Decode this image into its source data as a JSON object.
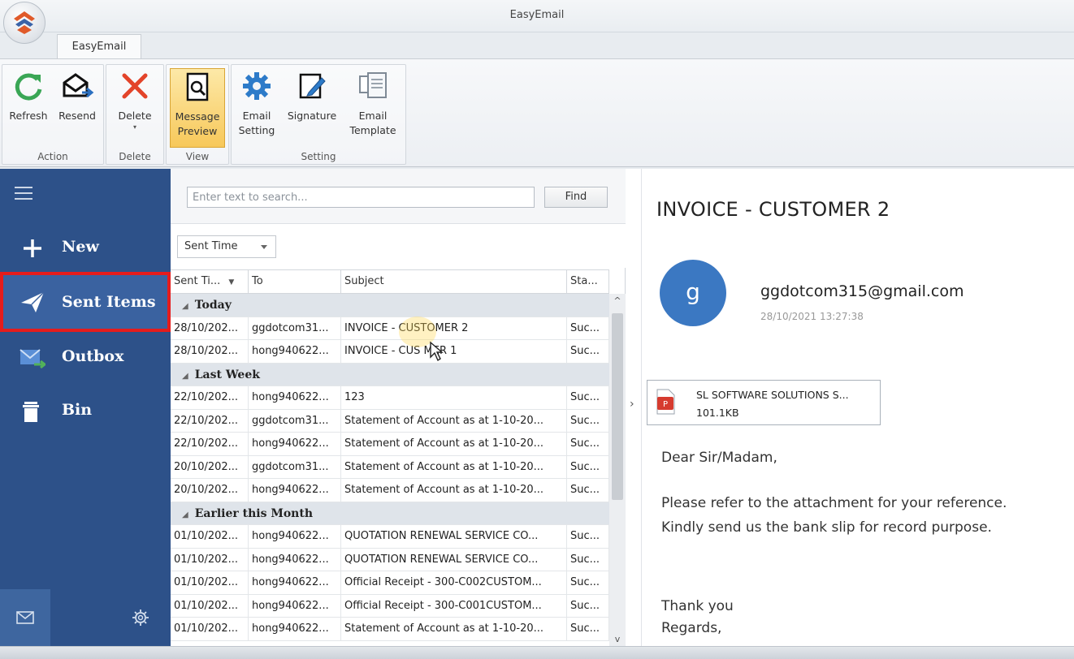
{
  "window": {
    "title": "EasyEmail",
    "tab": "EasyEmail"
  },
  "ribbon": {
    "groups": {
      "action": "Action",
      "delete": "Delete",
      "view": "View",
      "setting": "Setting"
    },
    "buttons": {
      "refresh": "Refresh",
      "resend": "Resend",
      "delete": "Delete",
      "message_preview_1": "Message",
      "message_preview_2": "Preview",
      "email_setting_1": "Email",
      "email_setting_2": "Setting",
      "signature": "Signature",
      "email_template_1": "Email",
      "email_template_2": "Template"
    }
  },
  "nav": {
    "items": [
      {
        "label": "New",
        "icon": "plus-icon"
      },
      {
        "label": "Sent Items",
        "icon": "paper-plane-icon"
      },
      {
        "label": "Outbox",
        "icon": "outbox-icon"
      },
      {
        "label": "Bin",
        "icon": "trash-icon"
      }
    ],
    "colors": {
      "background": "#2d5189",
      "highlight": "#e51c1c"
    }
  },
  "list": {
    "search_placeholder": "Enter text to search...",
    "find_label": "Find",
    "sort_label": "Sent Time",
    "columns": [
      "Sent Ti...",
      "To",
      "Subject",
      "Sta..."
    ],
    "groups": [
      {
        "label": "Today",
        "rows": [
          [
            "28/10/202...",
            "ggdotcom31...",
            "INVOICE - CUSTOMER 2",
            "Suc..."
          ],
          [
            "28/10/202...",
            "hong940622...",
            "INVOICE - CUS   MER 1",
            "Suc..."
          ]
        ]
      },
      {
        "label": "Last Week",
        "rows": [
          [
            "22/10/202...",
            "hong940622...",
            "123",
            "Suc..."
          ],
          [
            "22/10/202...",
            "ggdotcom31...",
            "Statement of Account as at 1-10-20...",
            "Suc..."
          ],
          [
            "22/10/202...",
            "hong940622...",
            "Statement of Account as at 1-10-20...",
            "Suc..."
          ],
          [
            "20/10/202...",
            "ggdotcom31...",
            "Statement of Account as at 1-10-20...",
            "Suc..."
          ],
          [
            "20/10/202...",
            "hong940622...",
            "Statement of Account as at 1-10-20...",
            "Suc..."
          ]
        ]
      },
      {
        "label": "Earlier this Month",
        "rows": [
          [
            "01/10/202...",
            "hong940622...",
            "QUOTATION RENEWAL SERVICE CO...",
            "Suc..."
          ],
          [
            "01/10/202...",
            "hong940622...",
            "QUOTATION RENEWAL SERVICE CO...",
            "Suc..."
          ],
          [
            "01/10/202...",
            "hong940622...",
            "Official Receipt - 300-C002CUSTOM...",
            "Suc..."
          ],
          [
            "01/10/202...",
            "hong940622...",
            "Official Receipt - 300-C001CUSTOM...",
            "Suc..."
          ],
          [
            "01/10/202...",
            "hong940622...",
            "Statement of Account as at 1-10-20...",
            "Suc..."
          ]
        ]
      }
    ]
  },
  "preview": {
    "subject": "INVOICE - CUSTOMER 2",
    "avatar_letter": "g",
    "sender": "ggdotcom315@gmail.com",
    "date": "28/10/2021 13:27:38",
    "attachment": {
      "name": "SL SOFTWARE SOLUTIONS S...",
      "size": "101.1KB",
      "icon": "pdf-icon"
    },
    "body": {
      "greeting": "Dear Sir/Madam,",
      "line1": "Please refer to the attachment for your reference.",
      "line2": "Kindly send us the bank slip for record purpose.",
      "thanks": "Thank you",
      "regards": "Regards,"
    }
  }
}
